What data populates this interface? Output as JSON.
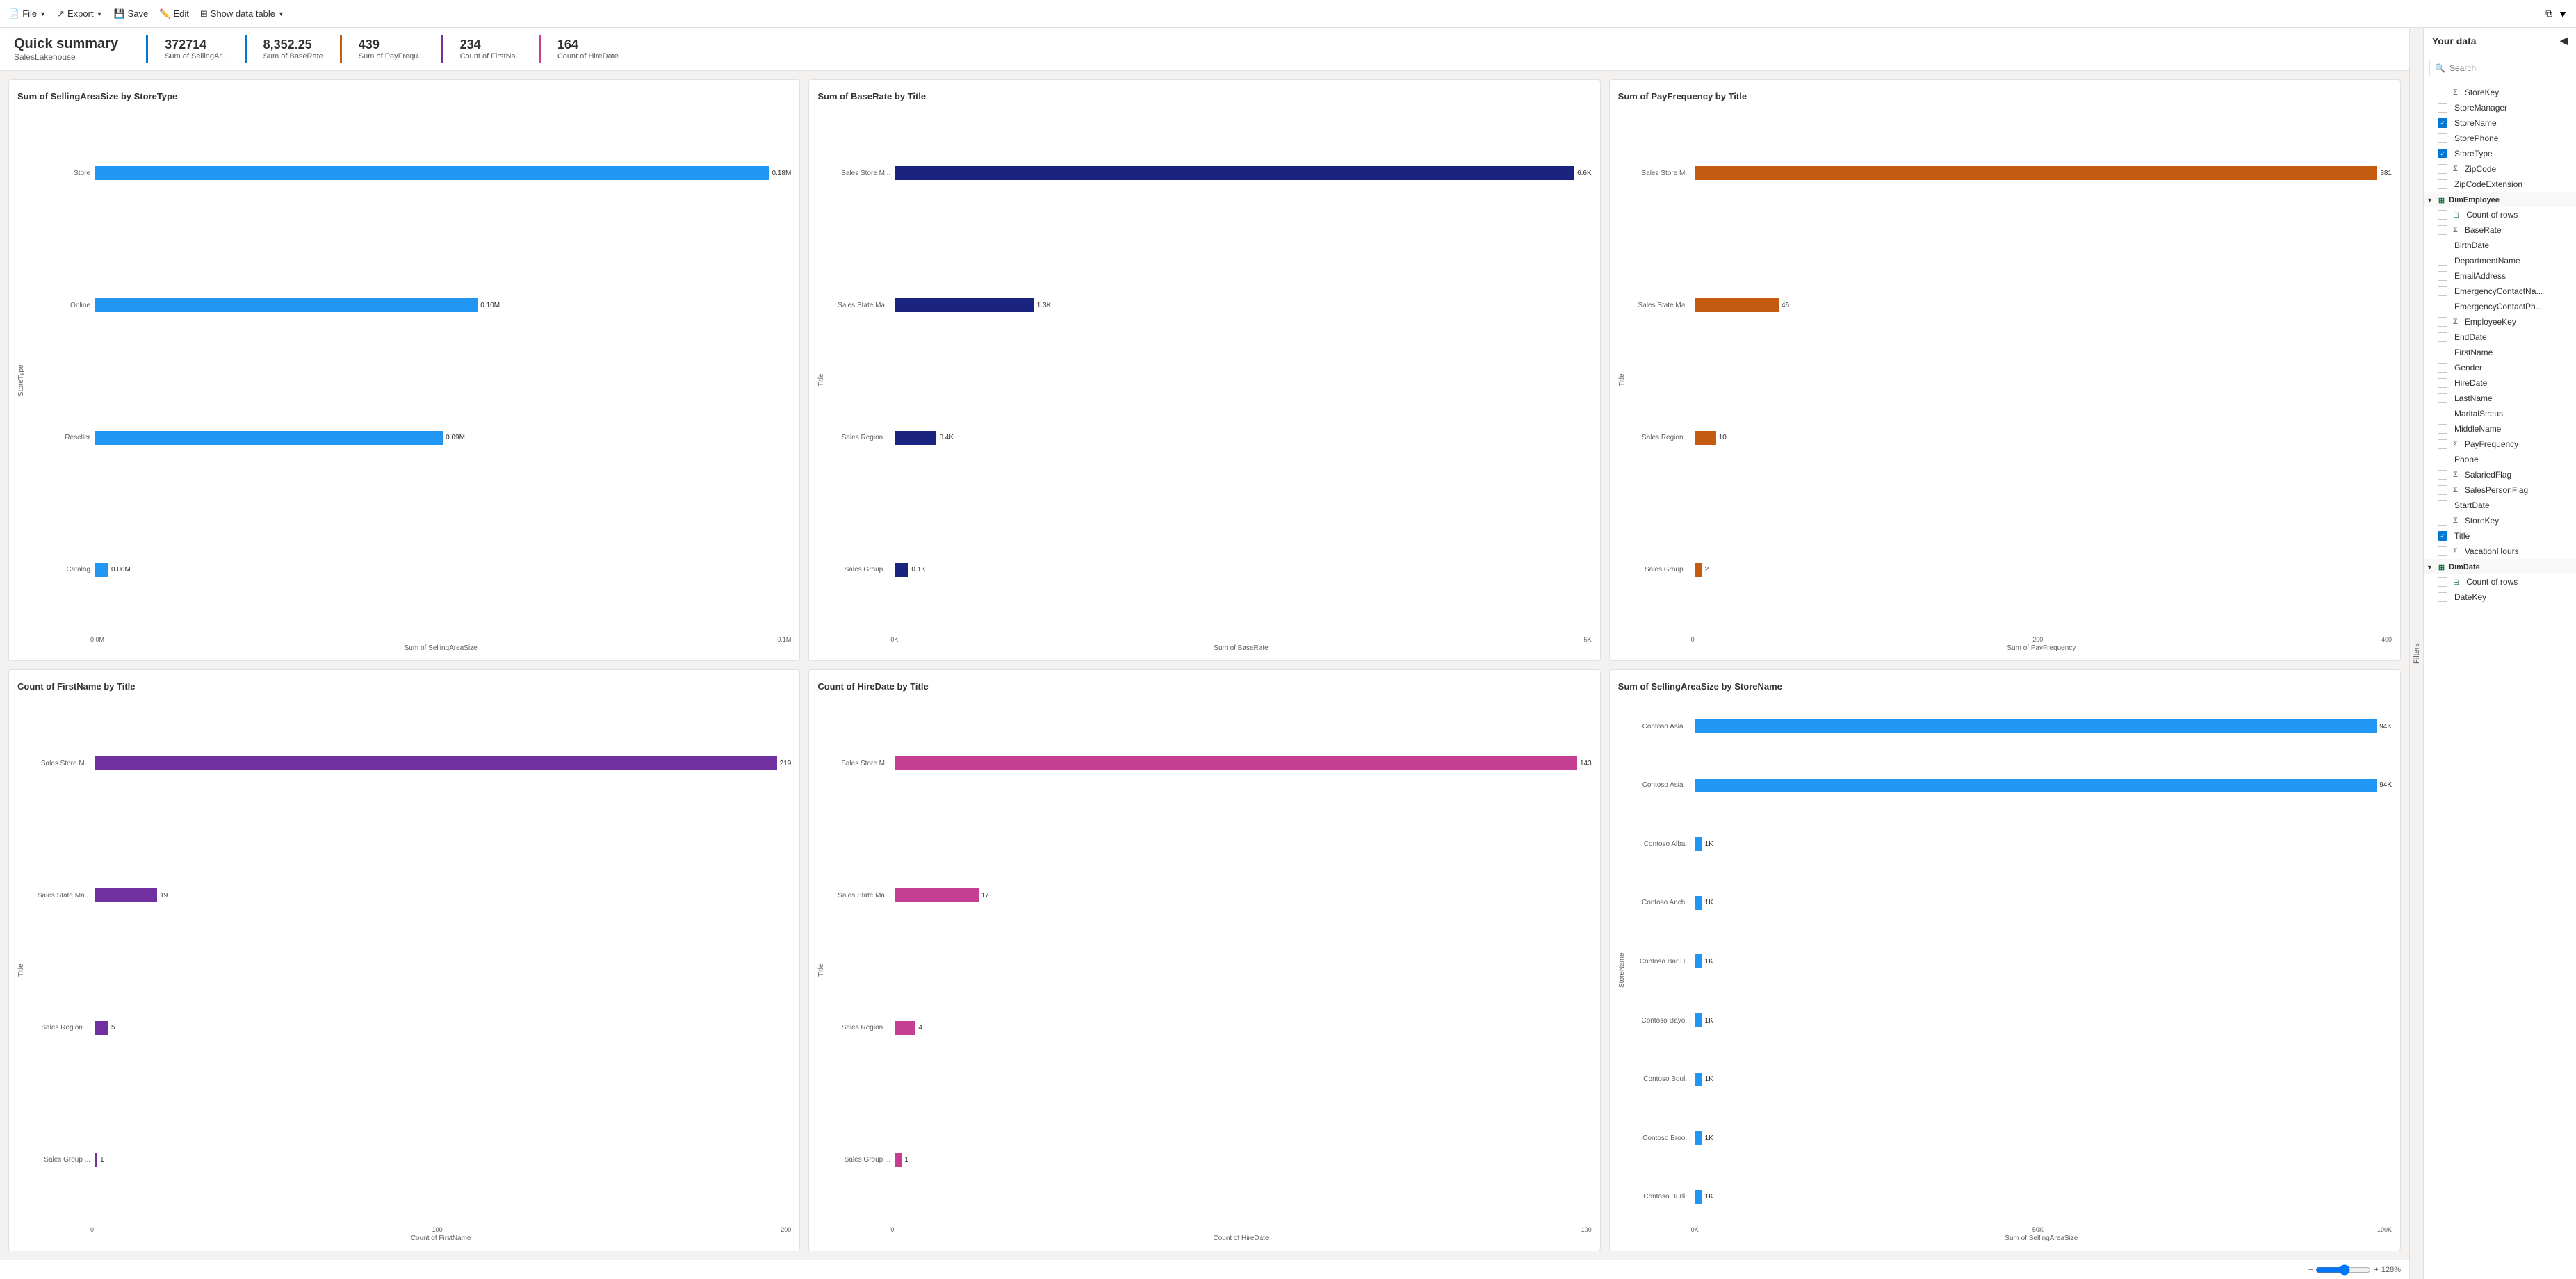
{
  "topbar": {
    "file_label": "File",
    "export_label": "Export",
    "save_label": "Save",
    "edit_label": "Edit",
    "show_data_table_label": "Show data table"
  },
  "header": {
    "title": "Quick summary",
    "subtitle": "SalesLakehouse"
  },
  "kpis": [
    {
      "value": "372714",
      "label": "Sum of SellingAr...",
      "color": "#0078d4"
    },
    {
      "value": "8,352.25",
      "label": "Sum of BaseRate",
      "color": "#0078d4"
    },
    {
      "value": "439",
      "label": "Sum of PayFrequ...",
      "color": "#c55a11"
    },
    {
      "value": "234",
      "label": "Count of FirstNa...",
      "color": "#7030a0"
    },
    {
      "value": "164",
      "label": "Count of HireDate",
      "color": "#c43e91"
    }
  ],
  "charts": [
    {
      "id": "chart1",
      "title": "Sum of SellingAreaSize by StoreType",
      "yLabel": "StoreType",
      "xLabel": "Sum of SellingAreaSize",
      "color": "#2196F3",
      "bars": [
        {
          "label": "Store",
          "value": 0.18,
          "displayVal": "0.18M",
          "pct": 100
        },
        {
          "label": "Online",
          "value": 0.1,
          "displayVal": "0.10M",
          "pct": 55
        },
        {
          "label": "Reseller",
          "value": 0.09,
          "displayVal": "0.09M",
          "pct": 50
        },
        {
          "label": "Catalog",
          "value": 0.0,
          "displayVal": "0.00M",
          "pct": 2
        }
      ],
      "xTicks": [
        "0.0M",
        "0.1M"
      ]
    },
    {
      "id": "chart2",
      "title": "Sum of BaseRate by Title",
      "yLabel": "Title",
      "xLabel": "Sum of BaseRate",
      "color": "#1a237e",
      "bars": [
        {
          "label": "Sales Store M...",
          "value": 6.6,
          "displayVal": "6.6K",
          "pct": 100
        },
        {
          "label": "Sales State Ma...",
          "value": 1.3,
          "displayVal": "1.3K",
          "pct": 20
        },
        {
          "label": "Sales Region ...",
          "value": 0.4,
          "displayVal": "0.4K",
          "pct": 6
        },
        {
          "label": "Sales Group ...",
          "value": 0.1,
          "displayVal": "0.1K",
          "pct": 2
        }
      ],
      "xTicks": [
        "0K",
        "5K"
      ]
    },
    {
      "id": "chart3",
      "title": "Sum of PayFrequency by Title",
      "yLabel": "Title",
      "xLabel": "Sum of PayFrequency",
      "color": "#c55a11",
      "bars": [
        {
          "label": "Sales Store M...",
          "value": 381,
          "displayVal": "381",
          "pct": 100
        },
        {
          "label": "Sales State Ma...",
          "value": 46,
          "displayVal": "46",
          "pct": 12
        },
        {
          "label": "Sales Region ...",
          "value": 10,
          "displayVal": "10",
          "pct": 3
        },
        {
          "label": "Sales Group ...",
          "value": 2,
          "displayVal": "2",
          "pct": 1
        }
      ],
      "xTicks": [
        "0",
        "200",
        "400"
      ]
    },
    {
      "id": "chart4",
      "title": "Count of FirstName by Title",
      "yLabel": "Title",
      "xLabel": "Count of FirstName",
      "color": "#7030a0",
      "bars": [
        {
          "label": "Sales Store M...",
          "value": 219,
          "displayVal": "219",
          "pct": 100
        },
        {
          "label": "Sales State Ma...",
          "value": 19,
          "displayVal": "19",
          "pct": 9
        },
        {
          "label": "Sales Region ...",
          "value": 5,
          "displayVal": "5",
          "pct": 2
        },
        {
          "label": "Sales Group ...",
          "value": 1,
          "displayVal": "1",
          "pct": 0
        }
      ],
      "xTicks": [
        "0",
        "100",
        "200"
      ]
    },
    {
      "id": "chart5",
      "title": "Count of HireDate by Title",
      "yLabel": "Title",
      "xLabel": "Count of HireDate",
      "color": "#c43e91",
      "bars": [
        {
          "label": "Sales Store M...",
          "value": 143,
          "displayVal": "143",
          "pct": 100
        },
        {
          "label": "Sales State Ma...",
          "value": 17,
          "displayVal": "17",
          "pct": 12
        },
        {
          "label": "Sales Region ...",
          "value": 4,
          "displayVal": "4",
          "pct": 3
        },
        {
          "label": "Sales Group ...",
          "value": 1,
          "displayVal": "1",
          "pct": 1
        }
      ],
      "xTicks": [
        "0",
        "100"
      ]
    },
    {
      "id": "chart6",
      "title": "Sum of SellingAreaSize by StoreName",
      "yLabel": "StoreName",
      "xLabel": "Sum of SellingAreaSize",
      "color": "#2196F3",
      "bars": [
        {
          "label": "Contoso Asia ...",
          "value": 94,
          "displayVal": "94K",
          "pct": 100
        },
        {
          "label": "Contoso Asia ...",
          "value": 94,
          "displayVal": "94K",
          "pct": 100
        },
        {
          "label": "Contoso Alba...",
          "value": 1,
          "displayVal": "1K",
          "pct": 1
        },
        {
          "label": "Contoso Anch...",
          "value": 1,
          "displayVal": "1K",
          "pct": 1
        },
        {
          "label": "Contoso Bar H...",
          "value": 1,
          "displayVal": "1K",
          "pct": 1
        },
        {
          "label": "Contoso Bayo...",
          "value": 1,
          "displayVal": "1K",
          "pct": 1
        },
        {
          "label": "Contoso Boul...",
          "value": 1,
          "displayVal": "1K",
          "pct": 1
        },
        {
          "label": "Contoso Broo...",
          "value": 1,
          "displayVal": "1K",
          "pct": 1
        },
        {
          "label": "Contoso Burli...",
          "value": 1,
          "displayVal": "1K",
          "pct": 1
        }
      ],
      "xTicks": [
        "0K",
        "50K",
        "100K"
      ]
    }
  ],
  "right_panel": {
    "title": "Your data",
    "search_placeholder": "Search",
    "filters_label": "Filters",
    "items": [
      {
        "type": "item",
        "indent": 1,
        "checked": false,
        "icon": "sigma",
        "label": "StoreKey"
      },
      {
        "type": "item",
        "indent": 1,
        "checked": false,
        "icon": "none",
        "label": "StoreManager"
      },
      {
        "type": "item",
        "indent": 1,
        "checked": true,
        "icon": "none",
        "label": "StoreName"
      },
      {
        "type": "item",
        "indent": 1,
        "checked": false,
        "icon": "none",
        "label": "StorePhone"
      },
      {
        "type": "item",
        "indent": 1,
        "checked": true,
        "icon": "none",
        "label": "StoreType"
      },
      {
        "type": "item",
        "indent": 1,
        "checked": false,
        "icon": "sigma",
        "label": "ZipCode"
      },
      {
        "type": "item",
        "indent": 1,
        "checked": false,
        "icon": "none",
        "label": "ZipCodeExtension"
      },
      {
        "type": "section",
        "indent": 0,
        "label": "DimEmployee",
        "icon": "table",
        "expanded": true
      },
      {
        "type": "item",
        "indent": 1,
        "checked": false,
        "icon": "table",
        "label": "Count of rows"
      },
      {
        "type": "item",
        "indent": 1,
        "checked": false,
        "icon": "sigma",
        "label": "BaseRate"
      },
      {
        "type": "item",
        "indent": 1,
        "checked": false,
        "icon": "none",
        "label": "BirthDate"
      },
      {
        "type": "item",
        "indent": 1,
        "checked": false,
        "icon": "none",
        "label": "DepartmentName"
      },
      {
        "type": "item",
        "indent": 1,
        "checked": false,
        "icon": "none",
        "label": "EmailAddress"
      },
      {
        "type": "item",
        "indent": 1,
        "checked": false,
        "icon": "none",
        "label": "EmergencyContactNa..."
      },
      {
        "type": "item",
        "indent": 1,
        "checked": false,
        "icon": "none",
        "label": "EmergencyContactPh..."
      },
      {
        "type": "item",
        "indent": 1,
        "checked": false,
        "icon": "sigma",
        "label": "EmployeeKey"
      },
      {
        "type": "item",
        "indent": 1,
        "checked": false,
        "icon": "none",
        "label": "EndDate"
      },
      {
        "type": "item",
        "indent": 1,
        "checked": false,
        "icon": "none",
        "label": "FirstName"
      },
      {
        "type": "item",
        "indent": 1,
        "checked": false,
        "icon": "none",
        "label": "Gender"
      },
      {
        "type": "item",
        "indent": 1,
        "checked": false,
        "icon": "none",
        "label": "HireDate"
      },
      {
        "type": "item",
        "indent": 1,
        "checked": false,
        "icon": "none",
        "label": "LastName"
      },
      {
        "type": "item",
        "indent": 1,
        "checked": false,
        "icon": "none",
        "label": "MaritalStatus"
      },
      {
        "type": "item",
        "indent": 1,
        "checked": false,
        "icon": "none",
        "label": "MiddleName"
      },
      {
        "type": "item",
        "indent": 1,
        "checked": false,
        "icon": "sigma",
        "label": "PayFrequency"
      },
      {
        "type": "item",
        "indent": 1,
        "checked": false,
        "icon": "none",
        "label": "Phone"
      },
      {
        "type": "item",
        "indent": 1,
        "checked": false,
        "icon": "sigma",
        "label": "SalariedFlag"
      },
      {
        "type": "item",
        "indent": 1,
        "checked": false,
        "icon": "sigma",
        "label": "SalesPersonFlag"
      },
      {
        "type": "item",
        "indent": 1,
        "checked": false,
        "icon": "none",
        "label": "StartDate"
      },
      {
        "type": "item",
        "indent": 1,
        "checked": false,
        "icon": "sigma",
        "label": "StoreKey"
      },
      {
        "type": "item",
        "indent": 1,
        "checked": true,
        "icon": "none",
        "label": "Title"
      },
      {
        "type": "item",
        "indent": 1,
        "checked": false,
        "icon": "sigma",
        "label": "VacationHours"
      },
      {
        "type": "section",
        "indent": 0,
        "label": "DimDate",
        "icon": "table",
        "expanded": true
      },
      {
        "type": "item",
        "indent": 1,
        "checked": false,
        "icon": "table",
        "label": "Count of rows"
      },
      {
        "type": "item",
        "indent": 1,
        "checked": false,
        "icon": "none",
        "label": "DateKey"
      }
    ]
  },
  "bottombar": {
    "zoom_label": "128%"
  }
}
